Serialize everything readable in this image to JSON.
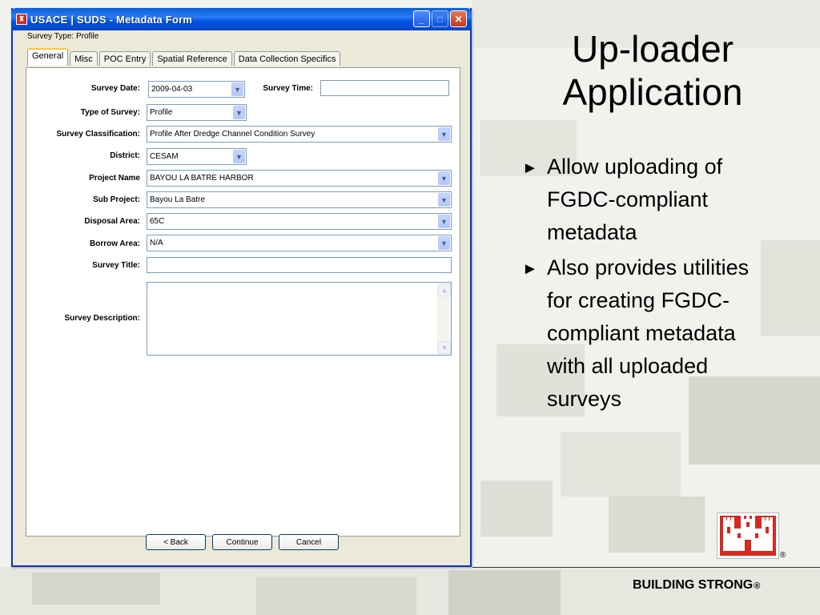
{
  "window": {
    "title": "USACE | SUDS - Metadata Form",
    "buttons": {
      "minimize": "_",
      "maximize": "□",
      "close": "✕"
    }
  },
  "survey_type": "Survey Type: Profile",
  "tabs": [
    {
      "label": "General",
      "active": true
    },
    {
      "label": "Misc"
    },
    {
      "label": "POC Entry"
    },
    {
      "label": "Spatial Reference"
    },
    {
      "label": "Data Collection Specifics"
    }
  ],
  "form": {
    "survey_date": {
      "label": "Survey Date:",
      "value": "2009-04-03"
    },
    "survey_time": {
      "label": "Survey Time:",
      "value": ""
    },
    "type_of_survey": {
      "label": "Type of Survey:",
      "value": "Profile"
    },
    "survey_classification": {
      "label": "Survey Classification:",
      "value": "Profile After Dredge Channel Condition Survey"
    },
    "district": {
      "label": "District:",
      "value": "CESAM"
    },
    "project_name": {
      "label": "Project Name",
      "value": "BAYOU LA BATRE HARBOR"
    },
    "sub_project": {
      "label": "Sub Project:",
      "value": "Bayou La Batre"
    },
    "disposal_area": {
      "label": "Disposal Area:",
      "value": "65C"
    },
    "borrow_area": {
      "label": "Borrow Area:",
      "value": "N/A"
    },
    "survey_title": {
      "label": "Survey Title:",
      "value": ""
    },
    "survey_description": {
      "label": "Survey Description:",
      "value": ""
    }
  },
  "buttons": {
    "back": "< Back",
    "continue": "Continue",
    "cancel": "Cancel"
  },
  "slide": {
    "title_line1": "Up-loader",
    "title_line2": "Application",
    "bullet_marker": "►",
    "bullets": [
      "Allow uploading of FGDC-compliant metadata",
      "Also provides utilities for creating FGDC-compliant metadata with all uploaded surveys"
    ]
  },
  "footer": {
    "brand": "BUILDING STRONG",
    "registered": "®"
  },
  "colors": {
    "title_bar": "#0054e3",
    "logo_red": "#d42a20",
    "tab_highlight": "#ffc83c"
  },
  "icons": [
    "usace-castle-icon",
    "minimize-icon",
    "maximize-icon",
    "close-icon",
    "dropdown-arrow-icon"
  ]
}
